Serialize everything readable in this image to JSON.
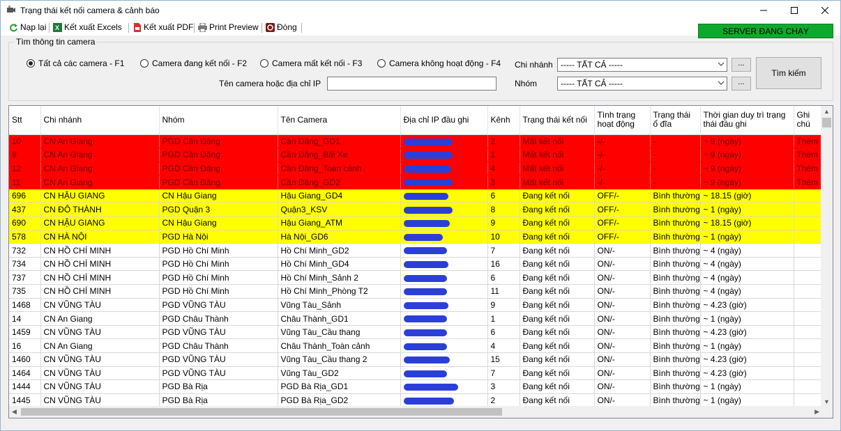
{
  "window": {
    "title": "Trạng thái kết nối camera & cảnh báo"
  },
  "toolbar": {
    "reload": "Nạp lại",
    "export_excel": "Kết xuất Excels",
    "export_pdf": "Kết xuất PDF",
    "print_preview": "Print Preview",
    "close": "Đóng",
    "server_status": "SERVER ĐANG CHẠY"
  },
  "search": {
    "group_title": "Tìm thông tin camera",
    "radio_all": "Tất cả các camera - F1",
    "radio_connected": "Camera đang kết nối - F2",
    "radio_disconnected": "Camera mất kết nối - F3",
    "radio_inactive": "Camera không hoạt động - F4",
    "branch_label": "Chi nhánh",
    "branch_value": "----- TẤT CẢ -----",
    "group_label": "Nhóm",
    "group_value": "----- TẤT CẢ -----",
    "name_ip_label": "Tên camera hoặc địa chỉ IP",
    "name_ip_value": "",
    "ellipsis": "...",
    "search_button": "Tìm kiếm"
  },
  "grid": {
    "columns": [
      "Stt",
      "Chi nhánh",
      "Nhóm",
      "Tên Camera",
      "Địa chỉ IP đầu ghi",
      "Kênh",
      "Trạng thái kết nối",
      "Tình trạng hoạt động",
      "Trạng thái ổ đĩa",
      "Thời gian duy trì trạng thái đầu ghi",
      "Ghi chú"
    ],
    "rows": [
      {
        "status": "red",
        "cells": [
          "10",
          "CN An Giang",
          "PGD Cần Đăng",
          "Cần Đăng_GD1",
          "",
          "2",
          "Mất kết nối",
          "-/-",
          "-",
          "~ 9 (ngày)",
          "Thêm g"
        ]
      },
      {
        "status": "red",
        "cells": [
          "9",
          "CN An Giang",
          "PGD Cần Đăng",
          "Cần Đăng_Bãi Xe",
          "",
          "1",
          "Mất kết nối",
          "-/-",
          "-",
          "~ 9 (ngày)",
          "Thêm g"
        ]
      },
      {
        "status": "red",
        "cells": [
          "12",
          "CN An Giang",
          "PGD Cần Đăng",
          "Cần Đăng_Toàn cảnh",
          "",
          "4",
          "Mất kết nối",
          "-/-",
          "-",
          "~ 9 (ngày)",
          "Thêm g"
        ]
      },
      {
        "status": "red",
        "cells": [
          "11",
          "CN An Giang",
          "PGD Cần Đăng",
          "Cần Đăng_GD2",
          "",
          "3",
          "Mất kết nối",
          "-/-",
          "-",
          "~ 9 (ngày)",
          "Thêm g"
        ]
      },
      {
        "status": "yellow",
        "cells": [
          "696",
          "CN HẬU GIANG",
          "CN Hậu Giang",
          "Hậu Giang_GD4",
          "",
          "6",
          "Đang kết nối",
          "OFF/-",
          "Bình thường",
          "~ 18.15 (giờ)",
          ""
        ]
      },
      {
        "status": "yellow",
        "cells": [
          "437",
          "CN ĐÔ THÀNH",
          "PGD Quận 3",
          "Quận3_KSV",
          "",
          "8",
          "Đang kết nối",
          "OFF/-",
          "Bình thường",
          "~ 1 (ngày)",
          ""
        ]
      },
      {
        "status": "yellow",
        "cells": [
          "690",
          "CN HẬU GIANG",
          "CN Hậu Giang",
          "Hậu Giang_ATM",
          "",
          "9",
          "Đang kết nối",
          "OFF/-",
          "Bình thường",
          "~ 18.15 (giờ)",
          ""
        ]
      },
      {
        "status": "yellow",
        "cells": [
          "578",
          "CN HÀ NỘI",
          "PGD Hà Nội",
          "Hà Nội_GD6",
          "",
          "10",
          "Đang kết nối",
          "OFF/-",
          "Bình thường",
          "~ 1 (ngày)",
          ""
        ]
      },
      {
        "status": "ok",
        "cells": [
          "732",
          "CN HỒ CHÍ MINH",
          "PGD Hồ Chí Minh",
          "Hồ Chí Minh_GD2",
          "",
          "7",
          "Đang kết nối",
          "ON/-",
          "Bình thường",
          "~ 4 (ngày)",
          ""
        ]
      },
      {
        "status": "ok",
        "cells": [
          "734",
          "CN HỒ CHÍ MINH",
          "PGD Hồ Chí Minh",
          "Hồ Chí Minh_GD4",
          "",
          "16",
          "Đang kết nối",
          "ON/-",
          "Bình thường",
          "~ 4 (ngày)",
          ""
        ]
      },
      {
        "status": "ok",
        "cells": [
          "737",
          "CN HỒ CHÍ MINH",
          "PGD Hồ Chí Minh",
          "Hồ Chí Minh_Sảnh 2",
          "",
          "6",
          "Đang kết nối",
          "ON/-",
          "Bình thường",
          "~ 4 (ngày)",
          ""
        ]
      },
      {
        "status": "ok",
        "cells": [
          "735",
          "CN HỒ CHÍ MINH",
          "PGD Hồ Chí Minh",
          "Hồ Chí Minh_Phòng T2",
          "",
          "11",
          "Đang kết nối",
          "ON/-",
          "Bình thường",
          "~ 4 (ngày)",
          ""
        ]
      },
      {
        "status": "ok",
        "cells": [
          "1468",
          "CN VŨNG TÀU",
          "PGD VŨNG TÀU",
          "Vũng Tàu_Sảnh",
          "",
          "9",
          "Đang kết nối",
          "ON/-",
          "Bình thường",
          "~ 4.23 (giờ)",
          ""
        ]
      },
      {
        "status": "ok",
        "cells": [
          "14",
          "CN An Giang",
          "PGD Châu Thành",
          "Châu Thành_GD1",
          "",
          "1",
          "Đang kết nối",
          "ON/-",
          "Bình thường",
          "~ 1 (ngày)",
          ""
        ]
      },
      {
        "status": "ok",
        "cells": [
          "1459",
          "CN VŨNG TÀU",
          "PGD VŨNG TÀU",
          "Vũng Tàu_Cầu thang",
          "",
          "6",
          "Đang kết nối",
          "ON/-",
          "Bình thường",
          "~ 4.23 (giờ)",
          ""
        ]
      },
      {
        "status": "ok",
        "cells": [
          "16",
          "CN An Giang",
          "PGD Châu Thành",
          "Châu Thành_Toàn cảnh",
          "",
          "4",
          "Đang kết nối",
          "ON/-",
          "Bình thường",
          "~ 1 (ngày)",
          ""
        ]
      },
      {
        "status": "ok",
        "cells": [
          "1460",
          "CN VŨNG TÀU",
          "PGD VŨNG TÀU",
          "Vũng Tàu_Cầu thang 2",
          "",
          "15",
          "Đang kết nối",
          "ON/-",
          "Bình thường",
          "~ 4.23 (giờ)",
          ""
        ]
      },
      {
        "status": "ok",
        "cells": [
          "1464",
          "CN VŨNG TÀU",
          "PGD VŨNG TÀU",
          "Vũng Tàu_GD2",
          "",
          "7",
          "Đang kết nối",
          "ON/-",
          "Bình thường",
          "~ 4.23 (giờ)",
          ""
        ]
      },
      {
        "status": "ok",
        "cells": [
          "1444",
          "CN VŨNG TÀU",
          "PGD Bà Rịa",
          "PGD Bà Rịa_GD1",
          "",
          "3",
          "Đang kết nối",
          "ON/-",
          "Bình thường",
          "~ 1 (ngày)",
          ""
        ]
      },
      {
        "status": "ok",
        "cells": [
          "1445",
          "CN VŨNG TÀU",
          "PGD Bà Rịa",
          "PGD Bà Rịa_GD2",
          "",
          "2",
          "Đang kết nối",
          "ON/-",
          "Bình thường",
          "~ 1 (ngày)",
          ""
        ]
      }
    ]
  },
  "colors": {
    "error_row": "#ff0000",
    "warning_row": "#ffff00",
    "server_ok": "#0fa82e",
    "ip_mask": "#2b3fd8"
  },
  "icons": {
    "reload": "refresh-icon",
    "excel": "excel-icon",
    "pdf": "pdf-icon",
    "print": "printer-icon",
    "close": "close-app-icon"
  }
}
